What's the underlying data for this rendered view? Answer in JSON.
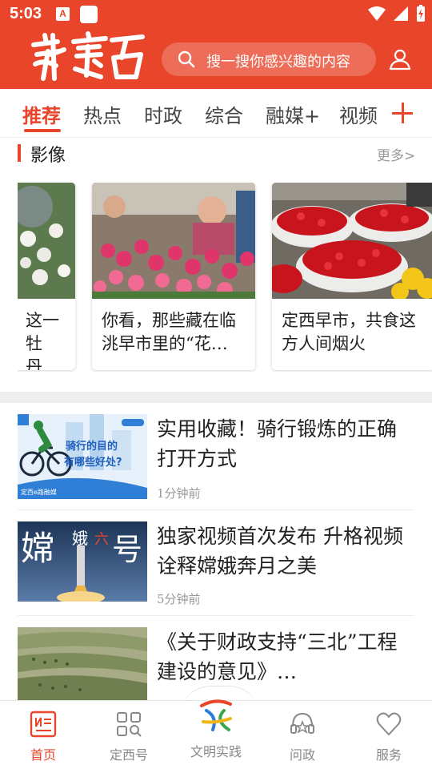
{
  "status_bar": {
    "time": "5:03",
    "app_badge": "A"
  },
  "header": {
    "logo_text": "新定西",
    "search_placeholder": "搜一搜你感兴趣的内容",
    "brand_color": "#e8452a"
  },
  "tabs": [
    {
      "label": "推荐",
      "active": true
    },
    {
      "label": "热点"
    },
    {
      "label": "时政"
    },
    {
      "label": "综合"
    },
    {
      "label": "融媒+"
    },
    {
      "label": "视频"
    }
  ],
  "section": {
    "title": "影像",
    "more": "更多>"
  },
  "gallery": [
    {
      "caption": "这一\n牡丹…"
    },
    {
      "caption": "你看，那些藏在临洮早市里的“花…"
    },
    {
      "caption": "定西早市，共食这方人间烟火"
    }
  ],
  "news": [
    {
      "title": "实用收藏！骑行锻炼的正确打开方式",
      "time": "1分钟前",
      "thumb_text_1": "骑行的目的",
      "thumb_text_2": "有哪些好处?",
      "thumb_tag": "定西e路融媒"
    },
    {
      "title": "独家视频首次发布  升格视频诠释嫦娥奔月之美",
      "time": "5分钟前",
      "thumb_text_1": "嫦",
      "thumb_text_2": "娥",
      "thumb_text_3": "六",
      "thumb_text_4": "号"
    },
    {
      "title": "《关于财政支持“三北”工程建设的意见》…",
      "time": ""
    }
  ],
  "bottom_nav": [
    {
      "label": "首页",
      "icon": "newspaper-icon",
      "active": true
    },
    {
      "label": "定西号",
      "icon": "grid-search-icon"
    },
    {
      "label": "文明实践",
      "icon": "wenming-logo-icon"
    },
    {
      "label": "问政",
      "icon": "headset-icon"
    },
    {
      "label": "服务",
      "icon": "heart-icon"
    }
  ]
}
